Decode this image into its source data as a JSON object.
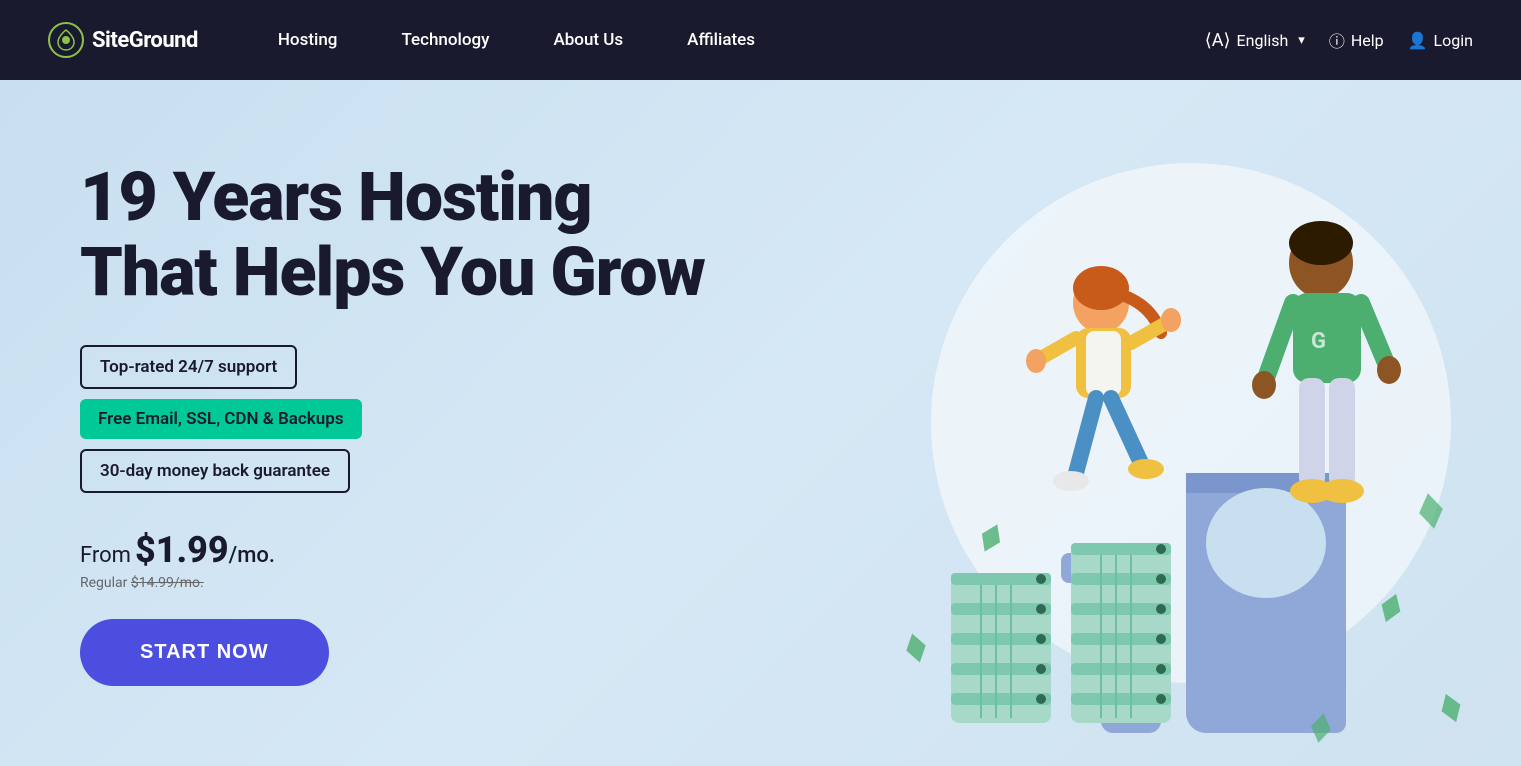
{
  "nav": {
    "logo_text": "SiteGround",
    "links": [
      {
        "label": "Hosting",
        "id": "hosting"
      },
      {
        "label": "Technology",
        "id": "technology"
      },
      {
        "label": "About Us",
        "id": "about-us"
      },
      {
        "label": "Affiliates",
        "id": "affiliates"
      }
    ],
    "lang_label": "English",
    "help_label": "Help",
    "login_label": "Login"
  },
  "hero": {
    "title_line1": "19 Years Hosting",
    "title_line2": "That Helps You Grow",
    "badge1": "Top-rated 24/7 support",
    "badge2": "Free Email, SSL, CDN & Backups",
    "badge3": "30-day money back guarantee",
    "price_from": "From",
    "price_amount": "$1.99",
    "price_period": "/mo.",
    "price_regular_label": "Regular",
    "price_regular": "$14.99/mo.",
    "cta_label": "START NOW"
  },
  "colors": {
    "accent_blue": "#4b4ede",
    "accent_green": "#00c896",
    "nav_bg": "#1a1a2e",
    "hero_bg": "#d6e8f5",
    "text_dark": "#1a1a2e"
  },
  "icons": {
    "logo": "circle-logo",
    "translate": "translate-icon",
    "help": "help-icon",
    "login": "login-icon",
    "chevron": "chevron-down-icon"
  }
}
